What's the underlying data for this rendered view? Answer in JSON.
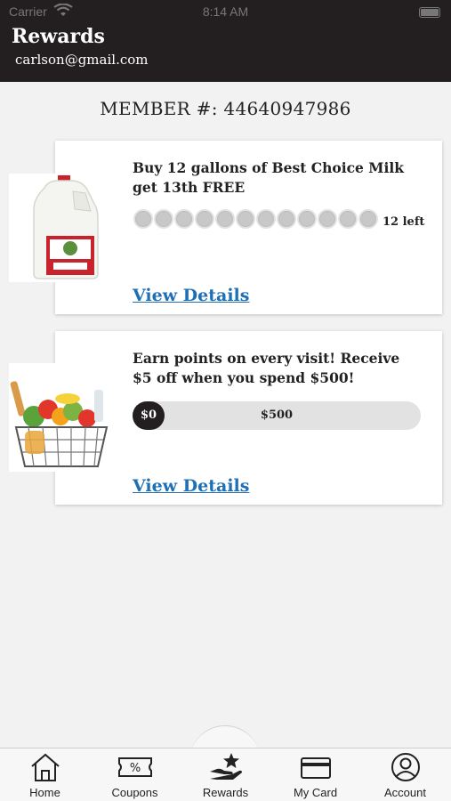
{
  "status": {
    "carrier": "Carrier",
    "time": "8:14 AM"
  },
  "header": {
    "title": "Rewards",
    "email": "carlson@gmail.com"
  },
  "member": {
    "label": "MEMBER #:",
    "number": "44640947986"
  },
  "rewards": [
    {
      "title": "Buy 12 gallons of Best Choice Milk get 13th FREE",
      "punches_total": 12,
      "punches_filled": 0,
      "remaining_label": "12 left",
      "link": "View Details",
      "image_icon": "milk-jug-image"
    },
    {
      "title": "Earn points on every visit! Receive $5 off when you spend $500!",
      "progress_current": "$0",
      "progress_goal": "$500",
      "progress_fraction": 0,
      "link": "View Details",
      "image_icon": "grocery-basket-image"
    }
  ],
  "tabs": [
    {
      "label": "Home",
      "icon": "home-icon"
    },
    {
      "label": "Coupons",
      "icon": "coupon-icon"
    },
    {
      "label": "Rewards",
      "icon": "rewards-icon"
    },
    {
      "label": "My Card",
      "icon": "card-icon"
    },
    {
      "label": "Account",
      "icon": "account-icon"
    }
  ],
  "colors": {
    "header": "#231f20",
    "link": "#1f6fb5",
    "background": "#f2f2f2"
  }
}
